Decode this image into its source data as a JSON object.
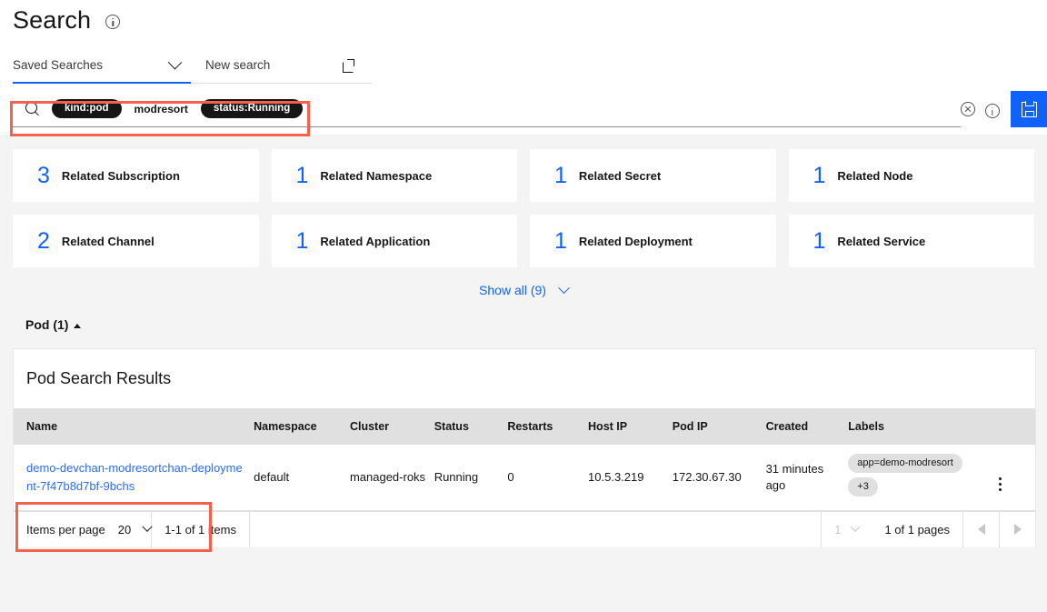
{
  "header": {
    "title": "Search",
    "info_icon": "info-icon",
    "tabs": [
      {
        "label": "Saved Searches",
        "icon": "chevron-down-icon",
        "active": true
      },
      {
        "label": "New search",
        "icon": "launch-icon",
        "active": false
      }
    ]
  },
  "search": {
    "glass_icon": "search-icon",
    "tokens": [
      {
        "text": "kind:pod",
        "style": "pill"
      },
      {
        "text": "modresort",
        "style": "plain"
      },
      {
        "text": "status:Running",
        "style": "pill"
      }
    ],
    "clear_icon": "close-circle-icon",
    "info_icon": "info-circle-icon",
    "save_icon": "save-icon",
    "accent_color": "#0f62fe",
    "highlight_color": "#f4624b"
  },
  "related_cards": [
    {
      "count": "3",
      "label": "Related Subscription"
    },
    {
      "count": "1",
      "label": "Related Namespace"
    },
    {
      "count": "1",
      "label": "Related Secret"
    },
    {
      "count": "1",
      "label": "Related Node"
    },
    {
      "count": "2",
      "label": "Related Channel"
    },
    {
      "count": "1",
      "label": "Related Application"
    },
    {
      "count": "1",
      "label": "Related Deployment"
    },
    {
      "count": "1",
      "label": "Related Service"
    }
  ],
  "show_all": {
    "label": "Show all (9)",
    "icon": "chevron-down-icon"
  },
  "section": {
    "title": "Pod (1)",
    "icon": "caret-up-icon"
  },
  "table": {
    "title": "Pod Search Results",
    "columns": [
      "Name",
      "Namespace",
      "Cluster",
      "Status",
      "Restarts",
      "Host IP",
      "Pod IP",
      "Created",
      "Labels"
    ],
    "rows": [
      {
        "name": "demo-devchan-modresortchan-deployment-7f47b8d7bf-9bchs",
        "namespace": "default",
        "cluster": "managed-roks",
        "status": "Running",
        "restarts": "0",
        "host_ip": "10.5.3.219",
        "pod_ip": "172.30.67.30",
        "created": "31 minutes ago",
        "labels": [
          "app=demo-modresort",
          "+3"
        ],
        "overflow_icon": "overflow-menu-icon"
      }
    ]
  },
  "pagination": {
    "items_per_page_label": "Items per page",
    "items_per_page_value": "20",
    "range_text": "1-1 of 1 items",
    "page_value": "1",
    "pages_text": "1 of 1 pages",
    "prev_icon": "caret-left-icon",
    "next_icon": "caret-right-icon"
  }
}
